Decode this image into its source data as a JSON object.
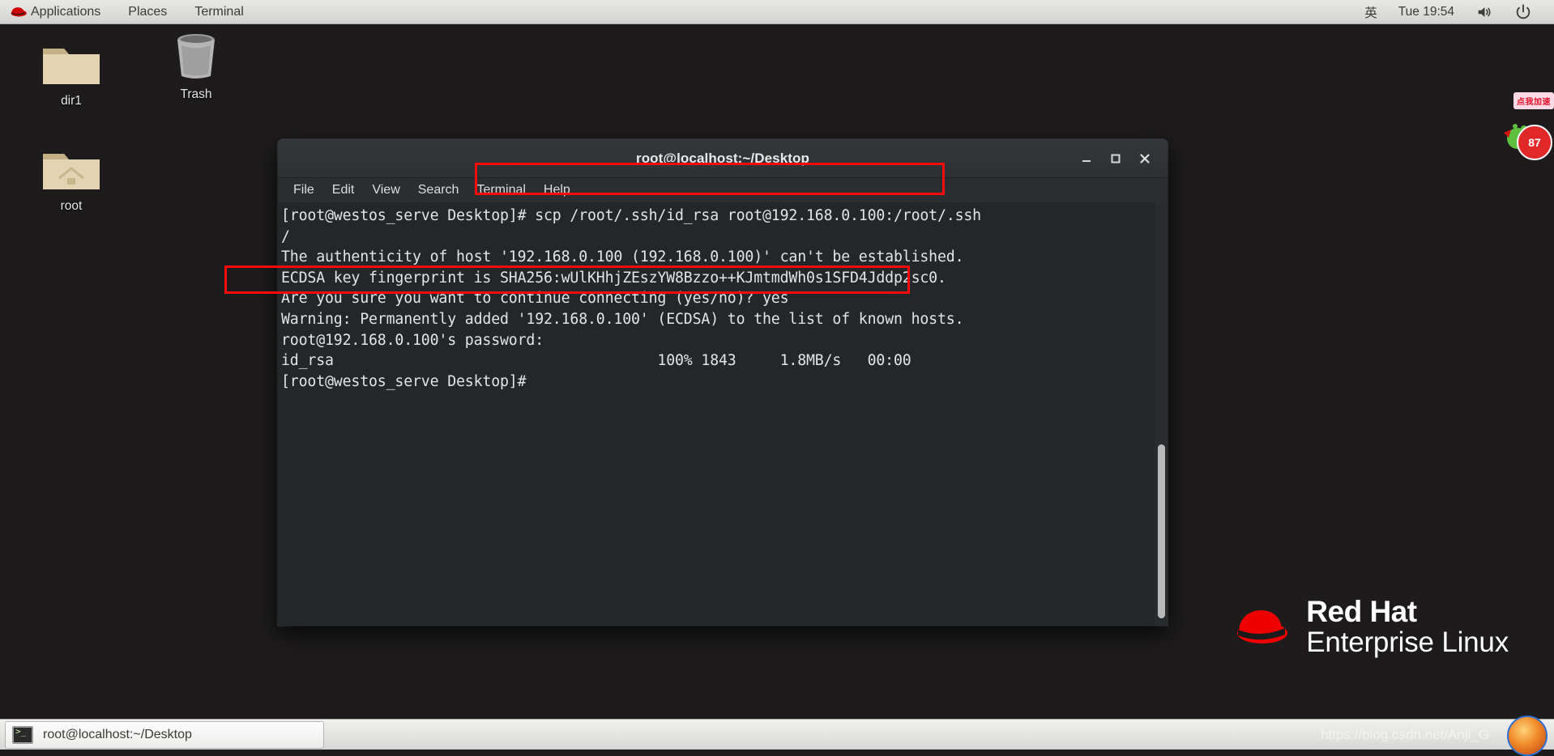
{
  "top_panel": {
    "left_items": [
      {
        "label": "Applications",
        "icon": "redhat-logo-icon"
      },
      {
        "label": "Places",
        "icon": null
      },
      {
        "label": "Terminal",
        "icon": null
      }
    ],
    "right_items": [
      {
        "label": "英",
        "name": "input-method-indicator"
      },
      {
        "label": "Tue 19:54",
        "name": "clock"
      },
      {
        "label": "",
        "name": "volume-icon"
      },
      {
        "label": "",
        "name": "power-icon"
      }
    ]
  },
  "desktop": {
    "icons": [
      {
        "label": "dir1",
        "type": "folder"
      },
      {
        "label": "Trash",
        "type": "trash"
      },
      {
        "label": "root",
        "type": "home-folder"
      }
    ],
    "brand": {
      "line1": "Red Hat",
      "line2": "Enterprise Linux"
    },
    "background_color": "#1d1b1c"
  },
  "ad_widget": {
    "bubble_text": "点我加速",
    "badge_text": "87"
  },
  "terminal": {
    "title": "root@localhost:~/Desktop",
    "menu": [
      "File",
      "Edit",
      "View",
      "Search",
      "Terminal",
      "Help"
    ],
    "window_buttons": {
      "minimize": "minimize-icon",
      "maximize": "maximize-icon",
      "close": "close-icon"
    },
    "background_color": "#23272a",
    "foreground_color": "#e4e4e4",
    "lines": [
      "[root@westos_serve Desktop]# scp /root/.ssh/id_rsa root@192.168.0.100:/root/.ssh",
      "/",
      "The authenticity of host '192.168.0.100 (192.168.0.100)' can't be established.",
      "ECDSA key fingerprint is SHA256:wUlKHhjZEszYW8Bzzo++KJmtmdWh0s1SFD4Jddp2sc0.",
      "Are you sure you want to continue connecting (yes/no)? yes",
      "Warning: Permanently added '192.168.0.100' (ECDSA) to the list of known hosts.",
      "root@192.168.0.100's password:",
      "id_rsa                                     100% 1843     1.8MB/s   00:00",
      "[root@westos_serve Desktop]#"
    ],
    "scrollbar": {
      "thumb_top_pct": 57,
      "thumb_height_pct": 41
    }
  },
  "annotations": {
    "color": "#fb0a0a",
    "boxes": [
      {
        "name": "command-highlight",
        "target": "scp /root/.ssh/id_rsa root@192.168.0.100:/root/.ssh"
      },
      {
        "name": "transfer-result-highlight",
        "target": "id_rsa 100% 1843 1.8MB/s 00:00"
      }
    ]
  },
  "taskbar": {
    "window_button_label": "root@localhost:~/Desktop",
    "watermark": "https://blog.csdn.net/Anji_G"
  }
}
